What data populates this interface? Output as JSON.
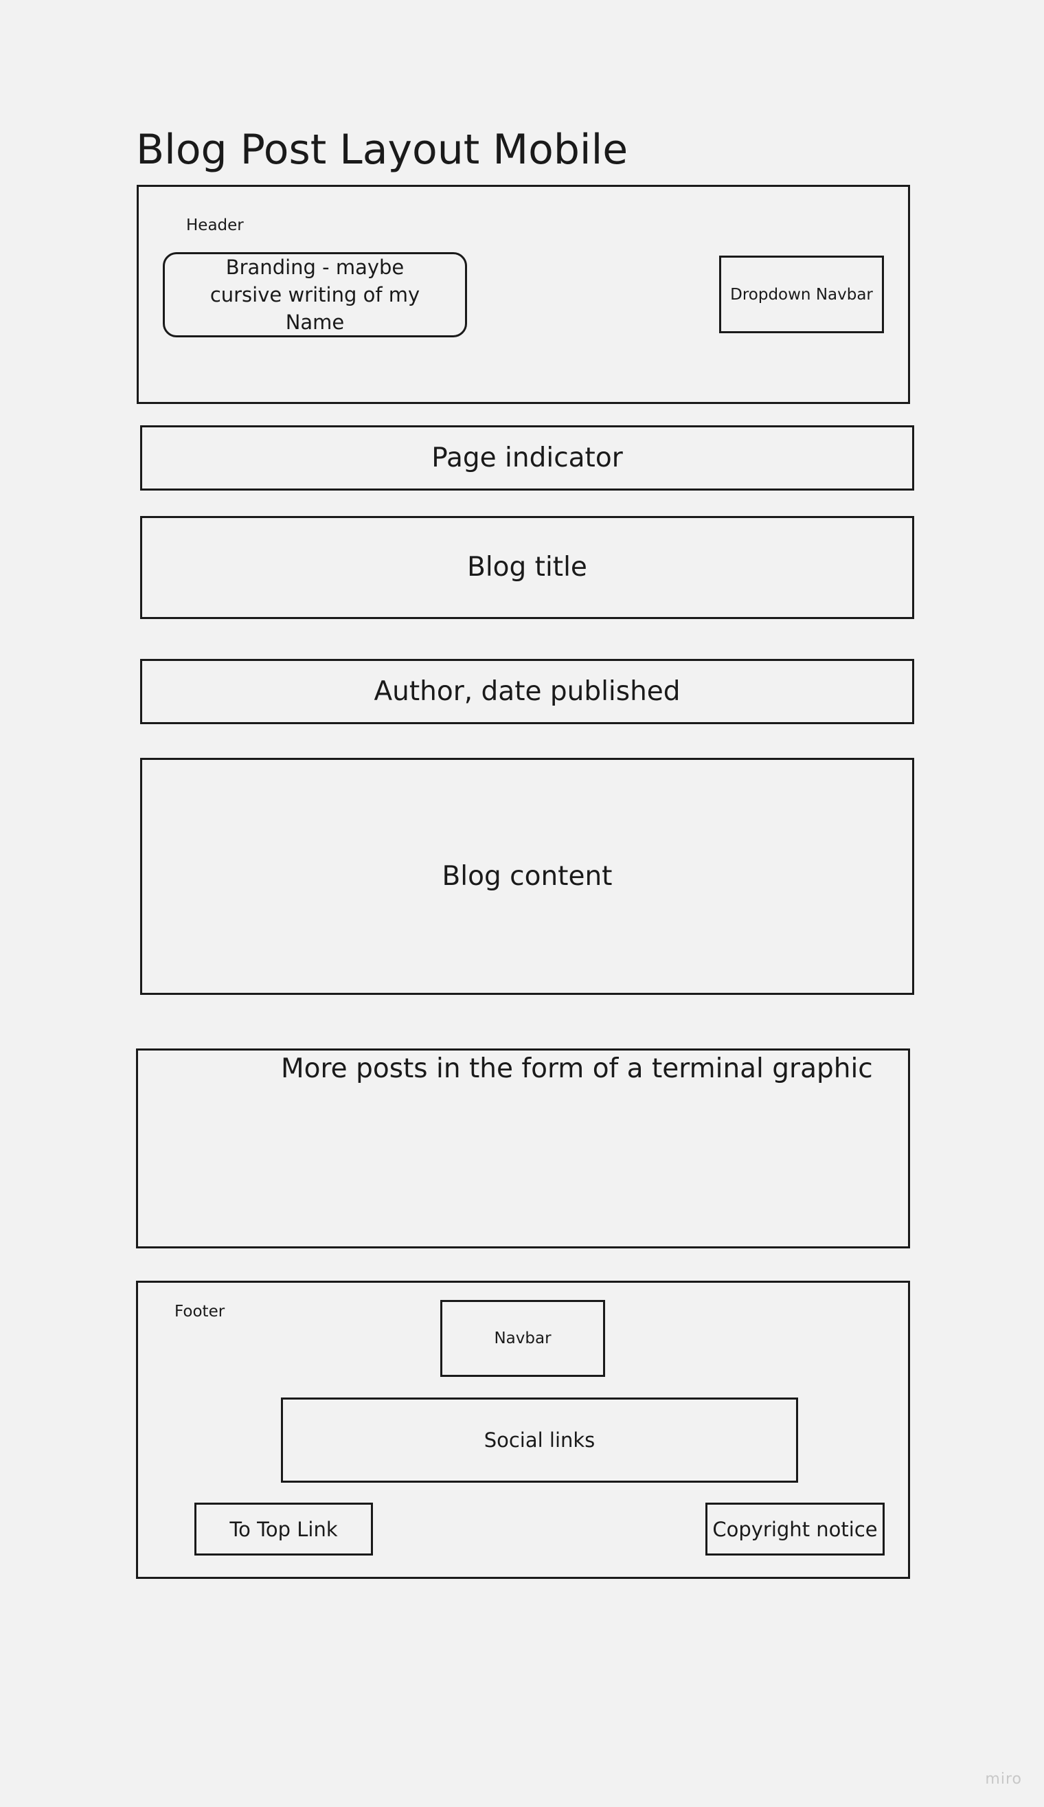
{
  "page_title": "Blog Post Layout Mobile",
  "header": {
    "label": "Header",
    "branding": "Branding - maybe cursive writing of my Name",
    "dropdown_navbar": "Dropdown Navbar"
  },
  "page_indicator": "Page indicator",
  "blog_title": "Blog title",
  "author_date": "Author, date published",
  "blog_content": "Blog content",
  "more_posts": "More posts in the form of a terminal graphic",
  "footer": {
    "label": "Footer",
    "navbar": "Navbar",
    "social_links": "Social links",
    "to_top_link": "To Top Link",
    "copyright_notice": "Copyright notice"
  },
  "watermark": "miro"
}
